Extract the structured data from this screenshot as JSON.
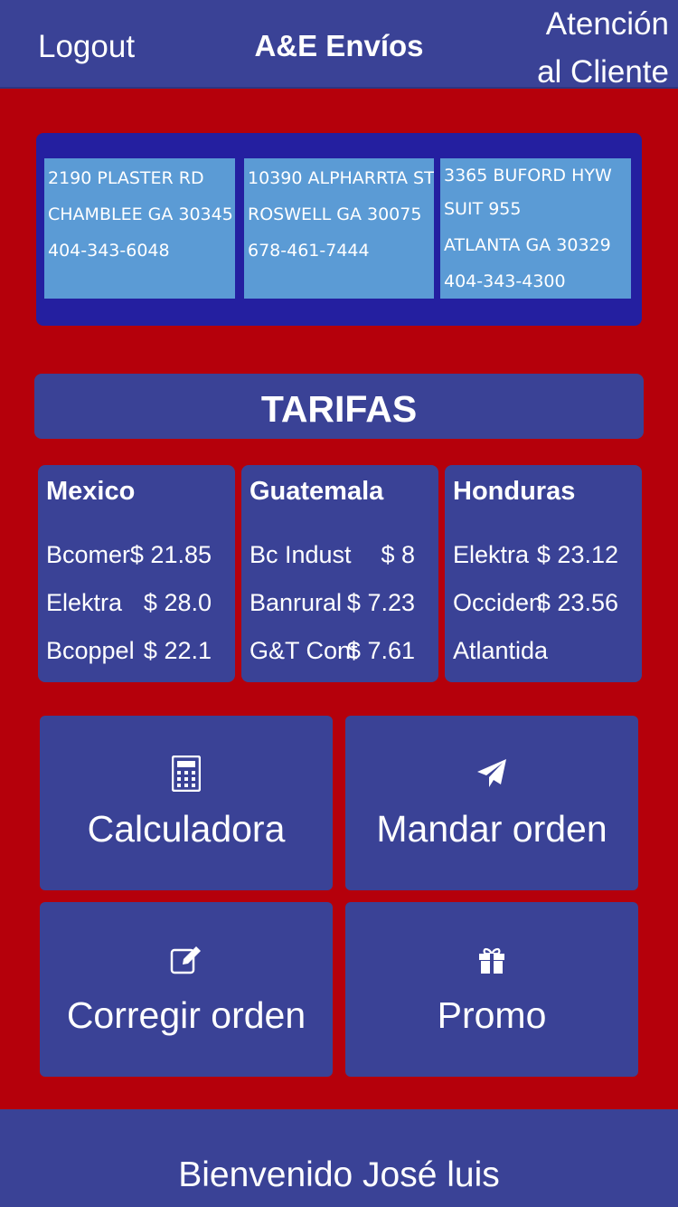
{
  "header": {
    "logout_label": "Logout",
    "title": "A&E Envíos",
    "support_line1": "Atención",
    "support_line2": "al Cliente"
  },
  "locations": [
    {
      "line1": "2190 PLASTER RD",
      "line2": "CHAMBLEE GA 30345",
      "line3": "404-343-6048"
    },
    {
      "line1": "10390 ALPHARRTA ST",
      "line2": "ROSWELL GA 30075",
      "line3": "678-461-7444"
    },
    {
      "line1": "3365 BUFORD HYW",
      "line2": "SUIT 955",
      "line3": "ATLANTA GA 30329",
      "line4": "404-343-4300"
    }
  ],
  "tarifas_title": "TARIFAS",
  "rates": [
    {
      "country": "Mexico",
      "rows": [
        {
          "bank": "Bcomer",
          "price": "$ 21.85"
        },
        {
          "bank": "Elektra",
          "price": "$ 28.0"
        },
        {
          "bank": "Bcoppel",
          "price": "$ 22.1"
        }
      ]
    },
    {
      "country": "Guatemala",
      "rows": [
        {
          "bank": "Bc Indust",
          "price": "$ 8"
        },
        {
          "bank": "Banrural",
          "price": "$ 7.23"
        },
        {
          "bank": "G&T Cont",
          "price": "$ 7.61"
        }
      ]
    },
    {
      "country": "Honduras",
      "rows": [
        {
          "bank": "Elektra",
          "price": "$ 23.12"
        },
        {
          "bank": "Occiden",
          "price": "$ 23.56"
        },
        {
          "bank": "Atlantida",
          "price": ""
        }
      ]
    }
  ],
  "actions": {
    "calculator": {
      "label": "Calculadora",
      "icon": "calculator-icon"
    },
    "send_order": {
      "label": "Mandar orden",
      "icon": "paper-plane-icon"
    },
    "edit_order": {
      "label": "Corregir orden",
      "icon": "edit-icon"
    },
    "promo": {
      "label": "Promo",
      "icon": "gift-icon"
    }
  },
  "footer": {
    "welcome": "Bienvenido José luis"
  },
  "colors": {
    "background": "#b5000b",
    "panel": "#3a4296",
    "address_panel": "#241fa0",
    "address_box": "#5b9bd5",
    "text": "#ffffff"
  }
}
